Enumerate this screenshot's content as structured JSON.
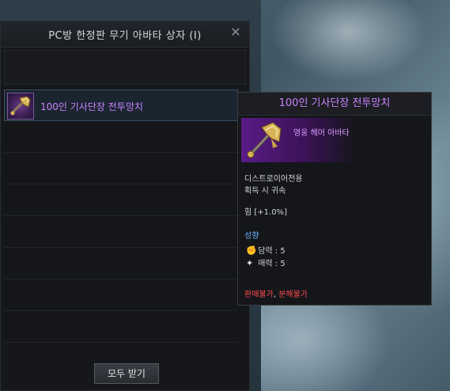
{
  "window": {
    "title": "PC방 한정판 무기 아바타 상자 (I)",
    "close_glyph": "✕",
    "receive_all_label": "모두 받기"
  },
  "list": {
    "items": [
      {
        "label": "100인 기사단장 전투망치",
        "icon": "warhammer-icon",
        "selected": true
      }
    ],
    "empty_rows": 7
  },
  "tooltip": {
    "title": "100인 기사단장 전투망치",
    "grade": "영웅 헤머 아바타",
    "class": "디스트로이어전용",
    "bind": "획득 시 귀속",
    "stat": "힘 [+1.0%]",
    "traits_label": "성향",
    "traits": [
      {
        "icon": "fist-icon",
        "glyph": "✊",
        "text": "담력 : 5"
      },
      {
        "icon": "sparkle-icon",
        "glyph": "✦",
        "text": "매력 : 5"
      }
    ],
    "warn_sell": "판매불가",
    "warn_sep": ",",
    "warn_disassemble": "분해불가"
  },
  "colors": {
    "hero_purple": "#c983ff",
    "section_blue": "#6fb7ff",
    "warning_red": "#ff4b4b"
  }
}
